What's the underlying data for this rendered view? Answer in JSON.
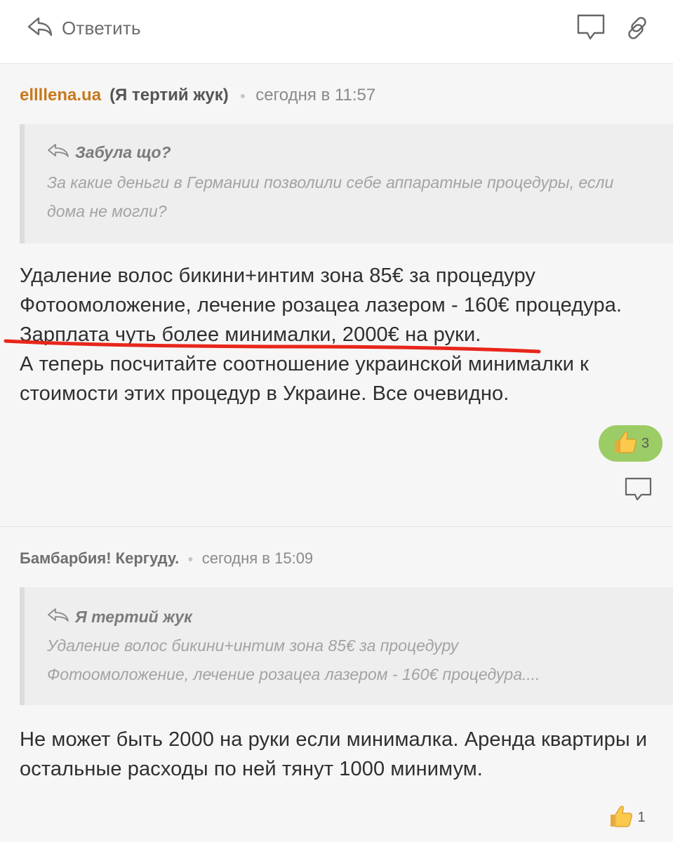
{
  "toolbar": {
    "reply_label": "Ответить"
  },
  "posts": [
    {
      "author": "ellllena.ua",
      "nickname": "(Я тертий жук)",
      "time": "сегодня в 11:57",
      "quote": {
        "author": "Забула що?",
        "lines": [
          "За какие деньги в Германии позволили себе аппаратные процедуры, если",
          "дома не могли?"
        ]
      },
      "body": [
        "Удаление волос бикини+интим зона 85€ за процедуру",
        "Фотоомоложение, лечение розацеа лазером - 160€ процедура.",
        "Зарплата чуть более минималки, 2000€ на руки.",
        "А теперь посчитайте соотношение украинской минималки к",
        "стоимости этих процедур в Украине. Все очевидно."
      ],
      "likes": "3"
    },
    {
      "author": "Бамбарбия! Кергуду.",
      "time": "сегодня в 15:09",
      "quote": {
        "author": "Я тертий жук",
        "lines": [
          "Удаление волос бикини+интим зона 85€ за процедуру",
          "Фотоомоложение, лечение розацеа лазером - 160€ процедура...."
        ]
      },
      "body": [
        "Не может быть 2000 на руки если минималка. Аренда квартиры и",
        "остальные расходы по ней тянут 1000 минимум."
      ],
      "likes": "1"
    }
  ],
  "colors": {
    "author_accent": "#c8781d",
    "like_active_bg": "#9ccc65",
    "annotation_underline": "#e8261b"
  },
  "icons": [
    "reply-arrow-icon",
    "comment-icon",
    "link-icon",
    "thumbs-up-icon"
  ]
}
